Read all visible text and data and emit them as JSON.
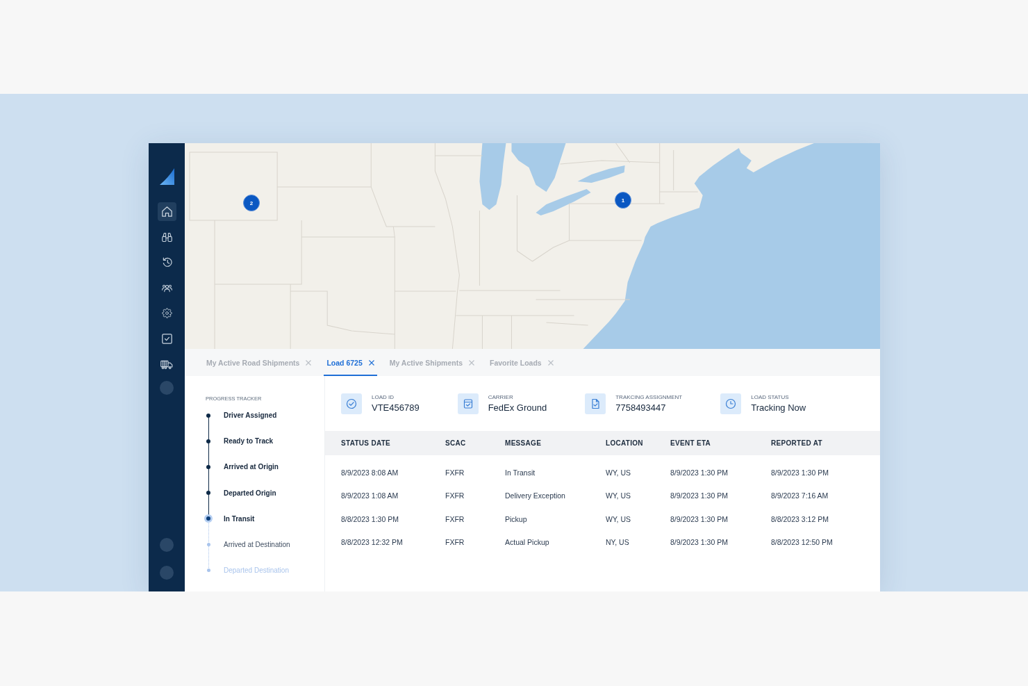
{
  "sidebar": {
    "nav": [
      {
        "selected": true
      },
      {
        "selected": false
      },
      {
        "selected": false
      },
      {
        "selected": false
      },
      {
        "selected": false
      },
      {
        "selected": false
      },
      {
        "selected": false
      }
    ]
  },
  "map": {
    "markers": [
      {
        "label": "2"
      },
      {
        "label": "1"
      }
    ]
  },
  "tabs": [
    {
      "label": "My Active Road Shipments",
      "selected": false
    },
    {
      "label": "Load 6725",
      "selected": true
    },
    {
      "label": "My Active Shipments",
      "selected": false
    },
    {
      "label": "Favorite Loads",
      "selected": false
    }
  ],
  "tracker": {
    "title": "PROGRESS TRACKER",
    "steps": [
      {
        "label": "Driver Assigned",
        "done": true,
        "current": false,
        "disabled": false
      },
      {
        "label": "Ready to Track",
        "done": true,
        "current": false,
        "disabled": false
      },
      {
        "label": "Arrived at Origin",
        "done": true,
        "current": false,
        "disabled": false
      },
      {
        "label": "Departed Origin",
        "done": true,
        "current": false,
        "disabled": false
      },
      {
        "label": "In Transit",
        "done": false,
        "current": true,
        "disabled": false
      },
      {
        "label": "Arrived at Destination",
        "done": false,
        "current": false,
        "disabled": false
      },
      {
        "label": "Departed Destination",
        "done": false,
        "current": false,
        "disabled": true
      }
    ]
  },
  "summary": [
    {
      "label": "LOAD ID",
      "value": "VTE456789"
    },
    {
      "label": "CARRIER",
      "value": "FedEx Ground"
    },
    {
      "label": "TRAKCING ASSIGNMENT",
      "value": "7758493447"
    },
    {
      "label": "LOAD STATUS",
      "value": "Tracking Now"
    }
  ],
  "table": {
    "columns": [
      "STATUS DATE",
      "SCAC",
      "MESSAGE",
      "LOCATION",
      "EVENT ETA",
      "REPORTED AT"
    ],
    "rows": [
      [
        "8/9/2023 8:08 AM",
        "FXFR",
        "In Transit",
        "WY, US",
        "8/9/2023 1:30 PM",
        "8/9/2023 1:30 PM"
      ],
      [
        "8/9/2023 1:08 AM",
        "FXFR",
        "Delivery Exception",
        "WY, US",
        "8/9/2023 1:30 PM",
        "8/9/2023 7:16 AM"
      ],
      [
        "8/8/2023 1:30 PM",
        "FXFR",
        "Pickup",
        "WY, US",
        "8/9/2023 1:30 PM",
        "8/8/2023 3:12 PM"
      ],
      [
        "8/8/2023 12:32 PM",
        "FXFR",
        "Actual Pickup",
        "NY, US",
        "8/9/2023 1:30 PM",
        "8/8/2023 12:50 PM"
      ]
    ]
  }
}
